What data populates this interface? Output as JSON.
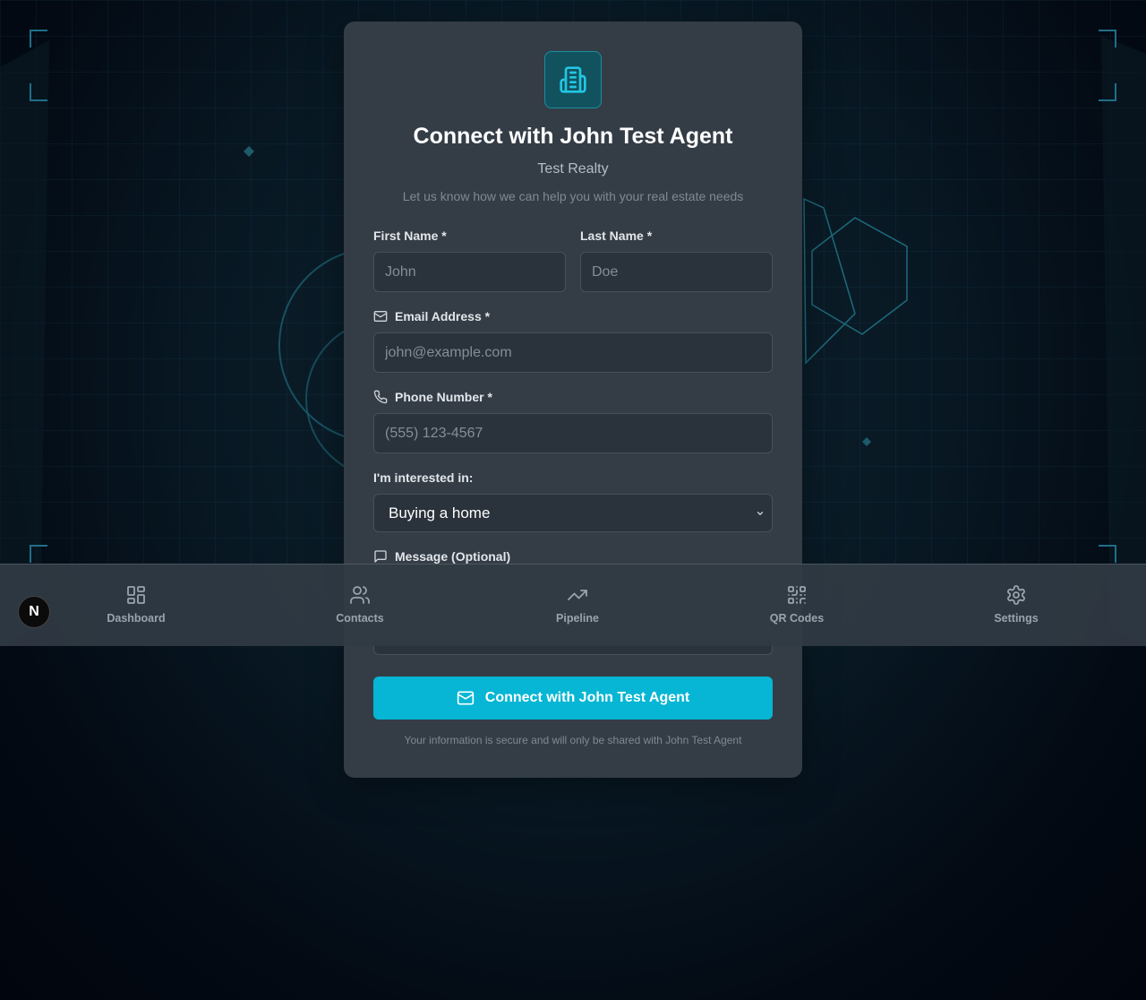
{
  "form": {
    "icon": "building-icon",
    "title": "Connect with John Test Agent",
    "company": "Test Realty",
    "description": "Let us know how we can help you with your real estate needs",
    "first_name": {
      "label": "First Name *",
      "placeholder": "John"
    },
    "last_name": {
      "label": "Last Name *",
      "placeholder": "Doe"
    },
    "email": {
      "label": "Email Address *",
      "placeholder": "john@example.com",
      "icon": "mail-icon"
    },
    "phone": {
      "label": "Phone Number *",
      "placeholder": "(555) 123-4567",
      "icon": "phone-icon"
    },
    "interest": {
      "label": "I'm interested in:",
      "selected": "Buying a home"
    },
    "message": {
      "label": "Message (Optional)",
      "icon": "message-icon"
    },
    "submit_label": "Connect with John Test Agent",
    "footnote": "Your information is secure and will only be shared with John Test Agent"
  },
  "nav": {
    "badge": "N",
    "items": [
      {
        "label": "Dashboard",
        "icon": "dashboard-icon"
      },
      {
        "label": "Contacts",
        "icon": "contacts-icon"
      },
      {
        "label": "Pipeline",
        "icon": "pipeline-icon"
      },
      {
        "label": "QR Codes",
        "icon": "qr-code-icon"
      },
      {
        "label": "Settings",
        "icon": "gear-icon"
      }
    ]
  },
  "colors": {
    "accent": "#06b6d4",
    "card": "#343d46",
    "background": "#030a14"
  }
}
